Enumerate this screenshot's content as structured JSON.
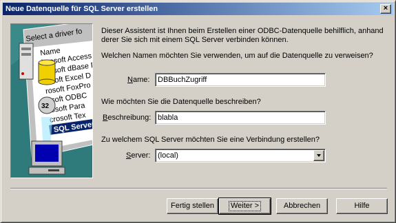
{
  "window": {
    "title": "Neue Datenquelle für SQL Server erstellen"
  },
  "artwork": {
    "list_heading": "Select a driver fo",
    "list_items": [
      "Name",
      "icrosoft Access D",
      "crosoft dBase Dr",
      "rosoft Excel D",
      "rosoft FoxPro",
      "osoft ODBC",
      "rosoft Para",
      "crosoft Tex",
      "SQL Server"
    ],
    "badge": "32"
  },
  "intro_text": "Dieser Assistent ist Ihnen beim Erstellen einer ODBC-Datenquelle behilflich, anhand derer Sie sich mit einem SQL Server verbinden können.",
  "name_section": {
    "question": "Welchen Namen möchten Sie verwenden, um auf die Datenquelle zu verweisen?",
    "label": "Name:",
    "value": "DBBuchZugriff"
  },
  "description_section": {
    "question": "Wie möchten Sie die Datenquelle beschreiben?",
    "label": "Beschreibung:",
    "value": "blabla"
  },
  "server_section": {
    "question": "Zu welchem SQL Server möchten Sie eine Verbindung erstellen?",
    "label": "Server:",
    "value": "(local)"
  },
  "buttons": {
    "finish": "Fertig stellen",
    "next": "Weiter >",
    "cancel": "Abbrechen",
    "help": "Hilfe"
  }
}
